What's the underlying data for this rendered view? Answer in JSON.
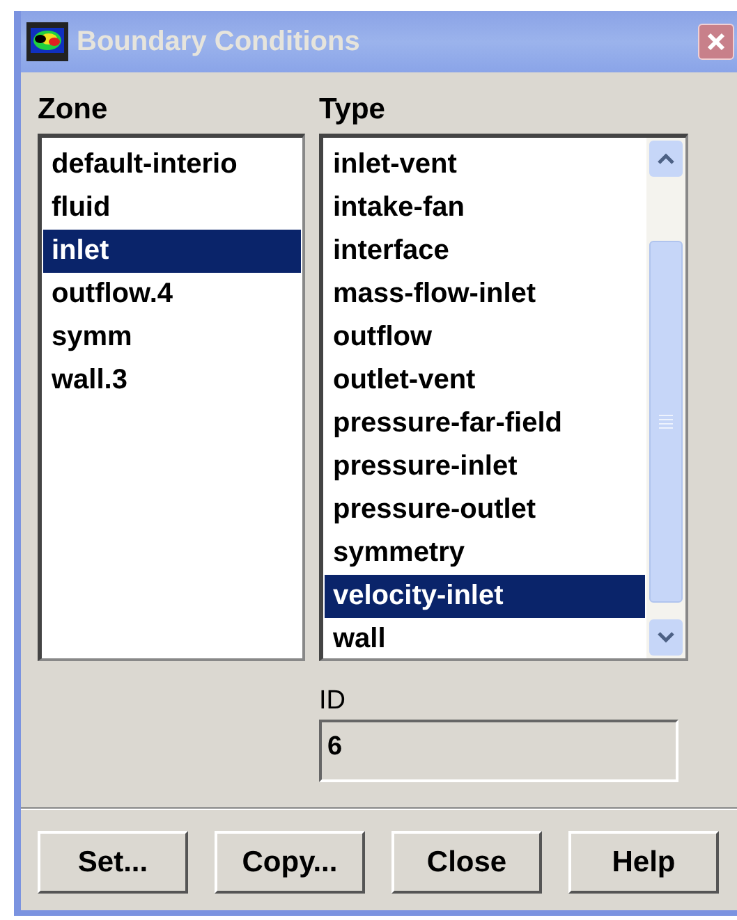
{
  "window": {
    "title": "Boundary Conditions"
  },
  "zone": {
    "label": "Zone",
    "items": [
      {
        "label": "default-interio",
        "selected": false
      },
      {
        "label": "fluid",
        "selected": false
      },
      {
        "label": "inlet",
        "selected": true
      },
      {
        "label": "outflow.4",
        "selected": false
      },
      {
        "label": "symm",
        "selected": false
      },
      {
        "label": "wall.3",
        "selected": false
      }
    ]
  },
  "type": {
    "label": "Type",
    "items": [
      {
        "label": "inlet-vent",
        "selected": false
      },
      {
        "label": "intake-fan",
        "selected": false
      },
      {
        "label": "interface",
        "selected": false
      },
      {
        "label": "mass-flow-inlet",
        "selected": false
      },
      {
        "label": "outflow",
        "selected": false
      },
      {
        "label": "outlet-vent",
        "selected": false
      },
      {
        "label": "pressure-far-field",
        "selected": false
      },
      {
        "label": "pressure-inlet",
        "selected": false
      },
      {
        "label": "pressure-outlet",
        "selected": false
      },
      {
        "label": "symmetry",
        "selected": false
      },
      {
        "label": "velocity-inlet",
        "selected": true
      },
      {
        "label": "wall",
        "selected": false
      }
    ]
  },
  "id": {
    "label": "ID",
    "value": "6"
  },
  "buttons": [
    "Set...",
    "Copy...",
    "Close",
    "Help"
  ]
}
